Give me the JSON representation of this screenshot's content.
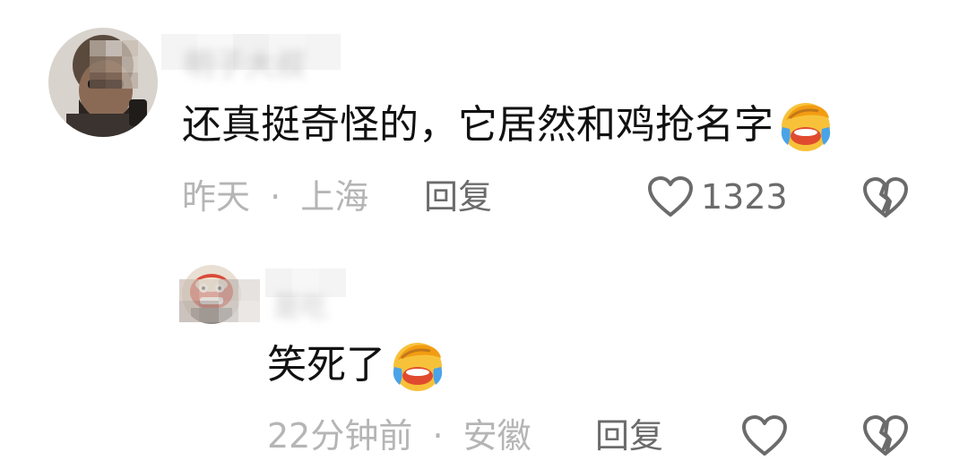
{
  "comments": [
    {
      "avatar": "avatar-bearded-man",
      "username": "明子大叔",
      "text": "还真挺奇怪的，它居然和鸡抢名字",
      "emoji": "face-with-tears-of-joy-icon",
      "time": "昨天",
      "separator": "·",
      "location": "上海",
      "reply_label": "回复",
      "like_count": "1323"
    }
  ],
  "replies": [
    {
      "avatar": "avatar-lion-dance",
      "username": "是吃",
      "text": "笑死了",
      "emoji": "face-with-tears-of-joy-icon",
      "time": "22分钟前",
      "separator": "·",
      "location": "安徽",
      "reply_label": "回复"
    }
  ],
  "colors": {
    "text_primary": "#111111",
    "text_meta": "#b5b5b5",
    "text_action": "#6b6b6b",
    "icon_stroke": "#6b6b6b"
  }
}
